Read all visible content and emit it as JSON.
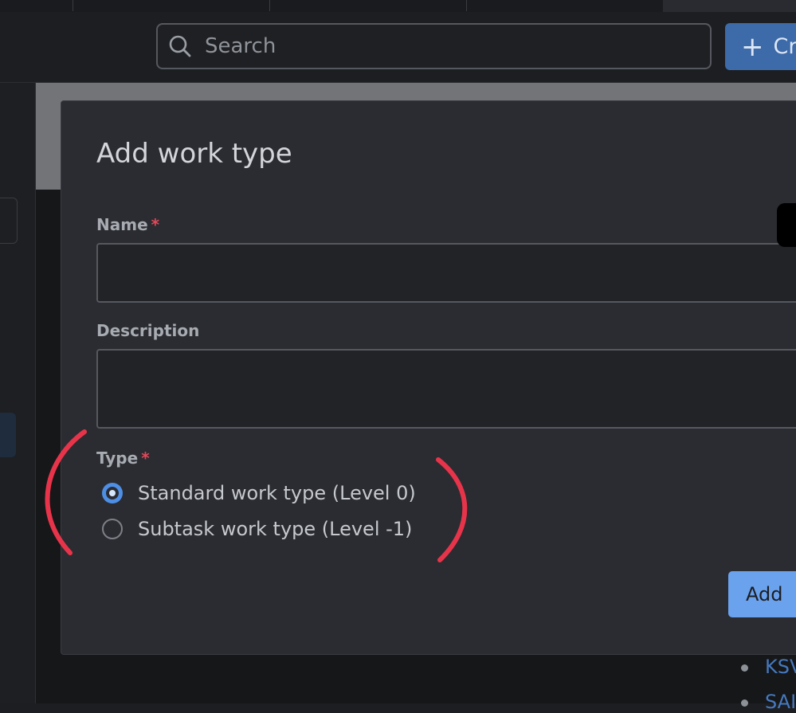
{
  "header": {
    "search_placeholder": "Search",
    "create_label": "Cr"
  },
  "modal": {
    "title": "Add work type",
    "name_label": "Name",
    "description_label": "Description",
    "type_label": "Type",
    "required_marker": "*",
    "options": [
      {
        "label": "Standard work type (Level 0)",
        "checked": true
      },
      {
        "label": "Subtask work type (Level -1)",
        "checked": false
      }
    ],
    "add_label": "Add"
  },
  "background_list": [
    "KSV",
    "SAI"
  ],
  "colors": {
    "primary": "#6aa2ee",
    "annotation": "#e8344a",
    "required": "#e2485a"
  }
}
